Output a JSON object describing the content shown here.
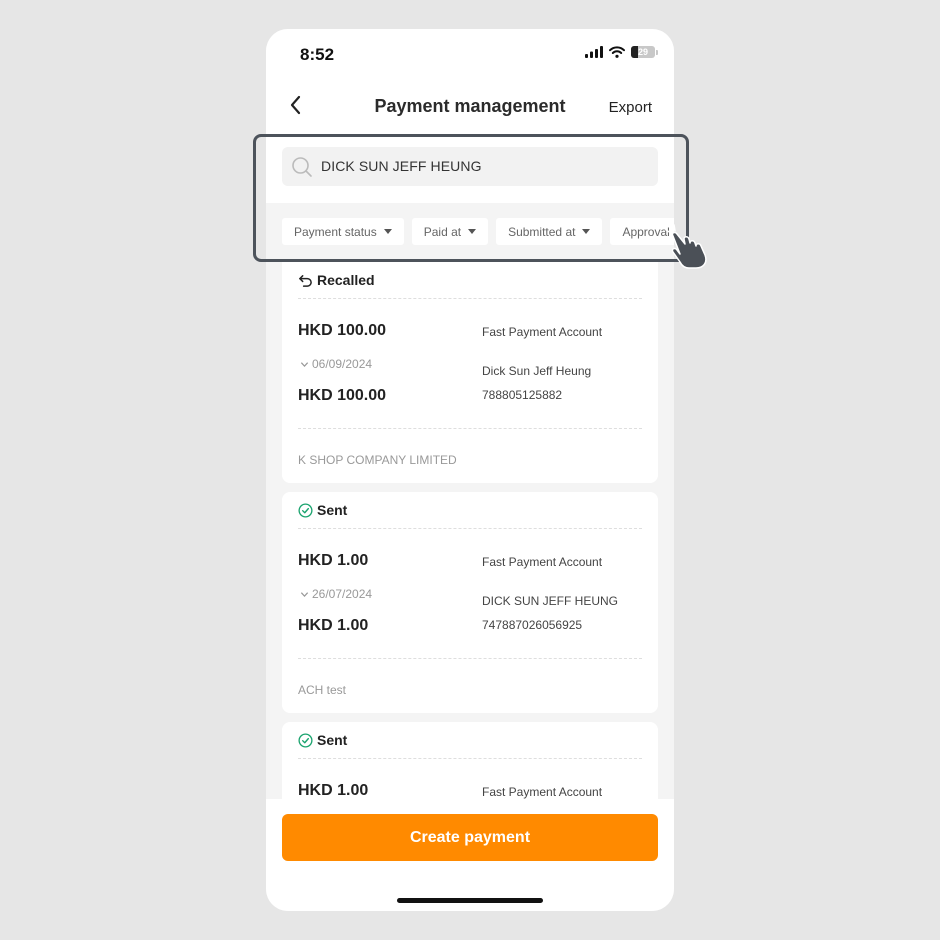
{
  "status_bar": {
    "time": "8:52",
    "battery": "29"
  },
  "header": {
    "title": "Payment management",
    "export_label": "Export"
  },
  "search": {
    "value": "DICK SUN JEFF HEUNG"
  },
  "filters": [
    "Payment status",
    "Paid at",
    "Submitted at",
    "Approval"
  ],
  "payments": [
    {
      "status": "Recalled",
      "amount": "HKD 100.00",
      "date": "06/09/2024",
      "amount2": "HKD 100.00",
      "account_type": "Fast Payment Account",
      "payee_name": "Dick Sun Jeff Heung",
      "account_number": "788805125882",
      "reference": "K SHOP COMPANY LIMITED"
    },
    {
      "status": "Sent",
      "amount": "HKD 1.00",
      "date": "26/07/2024",
      "amount2": "HKD 1.00",
      "account_type": "Fast Payment Account",
      "payee_name": "DICK SUN JEFF HEUNG",
      "account_number": "747887026056925",
      "reference": "ACH test"
    },
    {
      "status": "Sent",
      "amount": "HKD 1.00",
      "account_type": "Fast Payment Account"
    }
  ],
  "footer": {
    "create_label": "Create payment"
  },
  "colors": {
    "accent": "#ff8a00",
    "sent_icon": "#1aa36e",
    "highlight_border": "#4d535b"
  },
  "icons": [
    "back-icon",
    "search-icon",
    "signal-icon",
    "wifi-icon",
    "battery-icon",
    "recall-icon",
    "check-circle-icon",
    "chevron-down-icon",
    "pointing-hand-icon"
  ]
}
